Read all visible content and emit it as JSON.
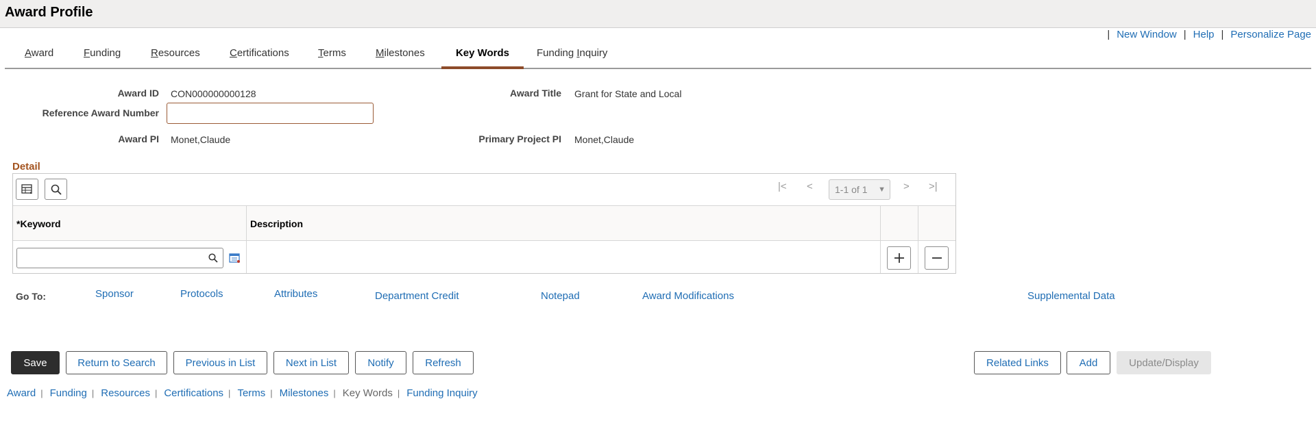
{
  "page": {
    "title": "Award Profile"
  },
  "top_links": [
    "New Window",
    "Help",
    "Personalize Page"
  ],
  "tabs": [
    {
      "label": "Award",
      "access": "A",
      "rest": "ward"
    },
    {
      "label": "Funding",
      "access": "F",
      "rest": "unding"
    },
    {
      "label": "Resources",
      "access": "R",
      "rest": "esources"
    },
    {
      "label": "Certifications",
      "access": "C",
      "rest": "ertifications"
    },
    {
      "label": "Terms",
      "access": "T",
      "rest": "erms"
    },
    {
      "label": "Milestones",
      "access": "M",
      "rest": "ilestones"
    },
    {
      "label": "Key Words",
      "active": true
    },
    {
      "label": "Funding Inquiry",
      "pre": "Funding ",
      "access": "I",
      "rest": "nquiry"
    }
  ],
  "fields": {
    "award_id_label": "Award ID",
    "award_id": "CON000000000128",
    "award_title_label": "Award Title",
    "award_title": "Grant for State and Local",
    "ref_award_label": "Reference Award Number",
    "ref_award_value": "",
    "award_pi_label": "Award PI",
    "award_pi": "Monet,Claude",
    "primary_pi_label": "Primary Project PI",
    "primary_pi": "Monet,Claude"
  },
  "detail": {
    "title": "Detail",
    "pager": "1-1 of 1",
    "col_keyword_req": "*",
    "col_keyword": "Keyword",
    "col_description": "Description",
    "keyword_value": "",
    "description_value": ""
  },
  "goto": {
    "label": "Go To:",
    "links": [
      "Sponsor",
      "Protocols",
      "Attributes",
      "Department Credit",
      "Notepad",
      "Award Modifications",
      "Supplemental Data"
    ]
  },
  "buttons": {
    "save": "Save",
    "return_to_search": "Return to Search",
    "previous_in_list": "Previous in List",
    "next_in_list": "Next in List",
    "notify": "Notify",
    "refresh": "Refresh",
    "related_links": "Related Links",
    "add": "Add",
    "update_display": "Update/Display"
  },
  "bottom_links": [
    "Award",
    "Funding",
    "Resources",
    "Certifications",
    "Terms",
    "Milestones",
    "Key Words",
    "Funding Inquiry"
  ],
  "bottom_current": "Key Words",
  "colors": {
    "accent": "#8d4b2a",
    "link": "#1f6db4",
    "section_title": "#a3531f",
    "primary_button": "#2d2d2d"
  }
}
